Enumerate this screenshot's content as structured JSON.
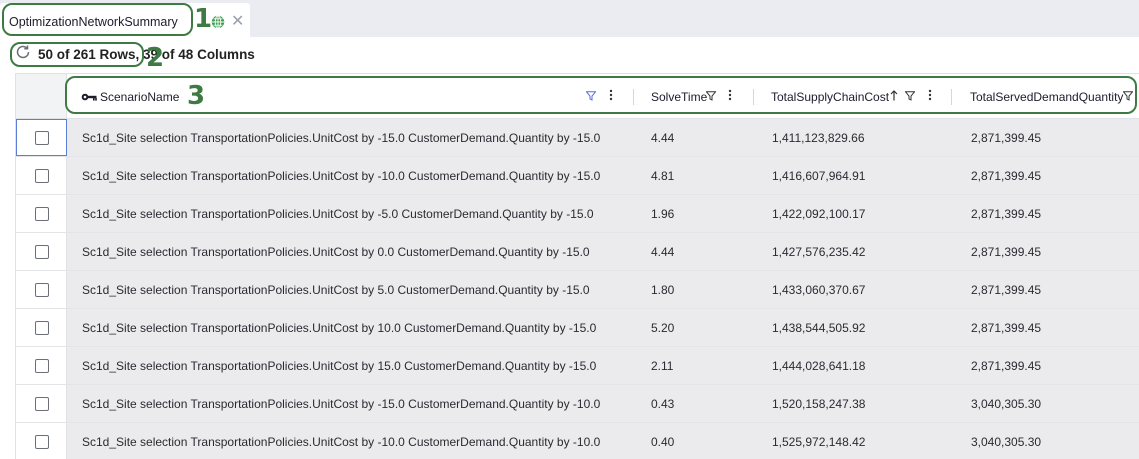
{
  "tab": {
    "title": "OptimizationNetworkSummary",
    "globe_icon": "globe-icon",
    "close_icon": "close-icon"
  },
  "info": {
    "row_count": "50 of 261 Rows, 39 of 48 Columns"
  },
  "callouts": [
    "1",
    "2",
    "3"
  ],
  "columns": [
    {
      "label": "ScenarioName",
      "key": true
    },
    {
      "label": "SolveTime"
    },
    {
      "label": "TotalSupplyChainCost",
      "sort": "ascending"
    },
    {
      "label": "TotalServedDemandQuantity"
    }
  ],
  "rows": [
    [
      "Sc1d_Site selection TransportationPolicies.UnitCost by -15.0 CustomerDemand.Quantity by -15.0",
      "4.44",
      "1,411,123,829.66",
      "2,871,399.45"
    ],
    [
      "Sc1d_Site selection TransportationPolicies.UnitCost by -10.0 CustomerDemand.Quantity by -15.0",
      "4.81",
      "1,416,607,964.91",
      "2,871,399.45"
    ],
    [
      "Sc1d_Site selection TransportationPolicies.UnitCost by -5.0 CustomerDemand.Quantity by -15.0",
      "1.96",
      "1,422,092,100.17",
      "2,871,399.45"
    ],
    [
      "Sc1d_Site selection TransportationPolicies.UnitCost by 0.0 CustomerDemand.Quantity by -15.0",
      "4.44",
      "1,427,576,235.42",
      "2,871,399.45"
    ],
    [
      "Sc1d_Site selection TransportationPolicies.UnitCost by 5.0 CustomerDemand.Quantity by -15.0",
      "1.80",
      "1,433,060,370.67",
      "2,871,399.45"
    ],
    [
      "Sc1d_Site selection TransportationPolicies.UnitCost by 10.0 CustomerDemand.Quantity by -15.0",
      "5.20",
      "1,438,544,505.92",
      "2,871,399.45"
    ],
    [
      "Sc1d_Site selection TransportationPolicies.UnitCost by 15.0 CustomerDemand.Quantity by -15.0",
      "2.11",
      "1,444,028,641.18",
      "2,871,399.45"
    ],
    [
      "Sc1d_Site selection TransportationPolicies.UnitCost by -15.0 CustomerDemand.Quantity by -10.0",
      "0.43",
      "1,520,158,247.38",
      "3,040,305.30"
    ],
    [
      "Sc1d_Site selection TransportationPolicies.UnitCost by -10.0 CustomerDemand.Quantity by -10.0",
      "0.40",
      "1,525,972,148.42",
      "3,040,305.30"
    ]
  ],
  "colors": {
    "callout": "#3e7b43",
    "filter_active": "#5b6bd6",
    "row_bg": "#ebebed",
    "tabstrip_bg": "#eaecf2"
  }
}
